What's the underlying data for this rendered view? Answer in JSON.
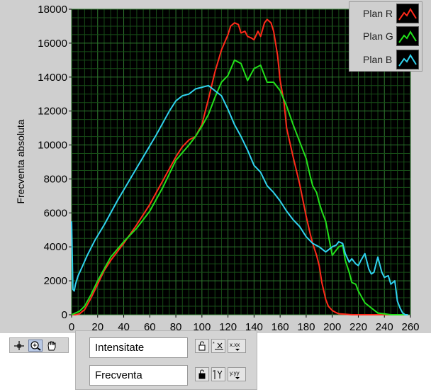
{
  "chart_data": {
    "type": "line",
    "ylabel": "Frecventa absoluta",
    "xlabel": "",
    "xlim": [
      0,
      260
    ],
    "ylim": [
      0,
      18000
    ],
    "x_ticks": [
      "0",
      "20",
      "40",
      "60",
      "80",
      "100",
      "120",
      "140",
      "160",
      "180",
      "200",
      "220",
      "240",
      "260"
    ],
    "y_ticks": [
      "0",
      "2000",
      "4000",
      "6000",
      "8000",
      "10000",
      "12000",
      "14000",
      "16000",
      "18000"
    ],
    "grid": true,
    "legend_position": "top-right",
    "background": "#000000",
    "series": [
      {
        "name": "Plan R",
        "color": "#ff2a1a",
        "x": [
          0,
          3,
          6,
          10,
          15,
          20,
          25,
          30,
          40,
          50,
          60,
          70,
          80,
          85,
          90,
          95,
          100,
          105,
          110,
          115,
          120,
          122,
          125,
          128,
          130,
          133,
          135,
          138,
          140,
          143,
          145,
          148,
          150,
          153,
          155,
          158,
          160,
          163,
          165,
          170,
          175,
          180,
          183,
          185,
          188,
          190,
          192,
          195,
          197,
          200,
          203,
          205,
          210,
          215,
          220,
          225,
          230,
          235,
          240,
          245,
          250,
          255
        ],
        "y": [
          0,
          0,
          50,
          300,
          1000,
          1800,
          2600,
          3200,
          4200,
          5300,
          6500,
          7900,
          9300,
          9900,
          10300,
          10500,
          11200,
          12700,
          14300,
          15600,
          16500,
          17000,
          17200,
          17100,
          16600,
          16700,
          16400,
          16300,
          16200,
          16700,
          16400,
          17200,
          17400,
          17200,
          16700,
          15300,
          13800,
          12500,
          11000,
          9300,
          7700,
          5800,
          4800,
          4200,
          3500,
          2900,
          1900,
          900,
          500,
          250,
          120,
          60,
          30,
          0,
          0,
          0,
          0,
          0,
          0,
          0,
          0,
          0
        ]
      },
      {
        "name": "Plan G",
        "color": "#22e01a",
        "x": [
          0,
          3,
          6,
          10,
          15,
          20,
          30,
          40,
          50,
          60,
          70,
          80,
          90,
          95,
          100,
          105,
          110,
          115,
          120,
          125,
          130,
          135,
          140,
          145,
          150,
          155,
          160,
          165,
          170,
          175,
          180,
          183,
          185,
          188,
          190,
          192,
          195,
          198,
          200,
          203,
          205,
          208,
          210,
          213,
          215,
          218,
          220,
          225,
          230,
          235,
          240,
          245,
          250,
          255,
          258
        ],
        "y": [
          0,
          100,
          200,
          500,
          1200,
          2000,
          3400,
          4300,
          5100,
          6100,
          7500,
          9100,
          10000,
          10500,
          11100,
          11800,
          12800,
          13700,
          14100,
          15000,
          14800,
          13800,
          14500,
          14700,
          13700,
          13700,
          13200,
          12300,
          11200,
          10200,
          9200,
          8200,
          7600,
          7200,
          6600,
          6100,
          5500,
          4300,
          3500,
          3800,
          4000,
          4100,
          3200,
          2500,
          1900,
          1800,
          1400,
          700,
          400,
          100,
          50,
          0,
          0,
          0,
          0
        ]
      },
      {
        "name": "Plan B",
        "color": "#30d2ee",
        "x": [
          0,
          1,
          2,
          3,
          5,
          8,
          12,
          18,
          25,
          35,
          45,
          55,
          65,
          75,
          80,
          85,
          90,
          95,
          100,
          105,
          110,
          115,
          120,
          125,
          130,
          135,
          140,
          145,
          150,
          155,
          160,
          165,
          170,
          175,
          180,
          185,
          190,
          195,
          200,
          203,
          205,
          208,
          210,
          213,
          215,
          218,
          220,
          222,
          225,
          228,
          230,
          232,
          235,
          238,
          240,
          243,
          245,
          248,
          250,
          252,
          254,
          256,
          258
        ],
        "y": [
          5500,
          1500,
          1400,
          1800,
          2300,
          2800,
          3500,
          4400,
          5300,
          6700,
          8000,
          9300,
          10600,
          12000,
          12600,
          12900,
          13000,
          13300,
          13400,
          13500,
          13200,
          12900,
          12100,
          11200,
          10500,
          9700,
          8800,
          8400,
          7600,
          7200,
          6700,
          6100,
          5600,
          5200,
          4600,
          4200,
          4000,
          3700,
          4000,
          4100,
          4300,
          4200,
          3600,
          3100,
          3300,
          3000,
          2900,
          3200,
          3600,
          2700,
          2400,
          2500,
          3400,
          2500,
          2200,
          2300,
          1800,
          2000,
          800,
          400,
          100,
          0,
          0
        ]
      }
    ]
  },
  "legend": {
    "items": [
      {
        "label": "Plan R",
        "color": "#ff2a1a"
      },
      {
        "label": "Plan G",
        "color": "#22e01a"
      },
      {
        "label": "Plan B",
        "color": "#30d2ee"
      }
    ]
  },
  "palette": {
    "tools": [
      {
        "name": "cursor-move-tool",
        "icon": "crosshair-icon"
      },
      {
        "name": "zoom-tool",
        "icon": "zoom-icon"
      },
      {
        "name": "pan-tool",
        "icon": "hand-icon"
      }
    ]
  },
  "scale_legend": {
    "x_name": "Intensitate",
    "y_name": "Frecventa",
    "x_format": "x.xx",
    "y_format": "y.yy"
  }
}
